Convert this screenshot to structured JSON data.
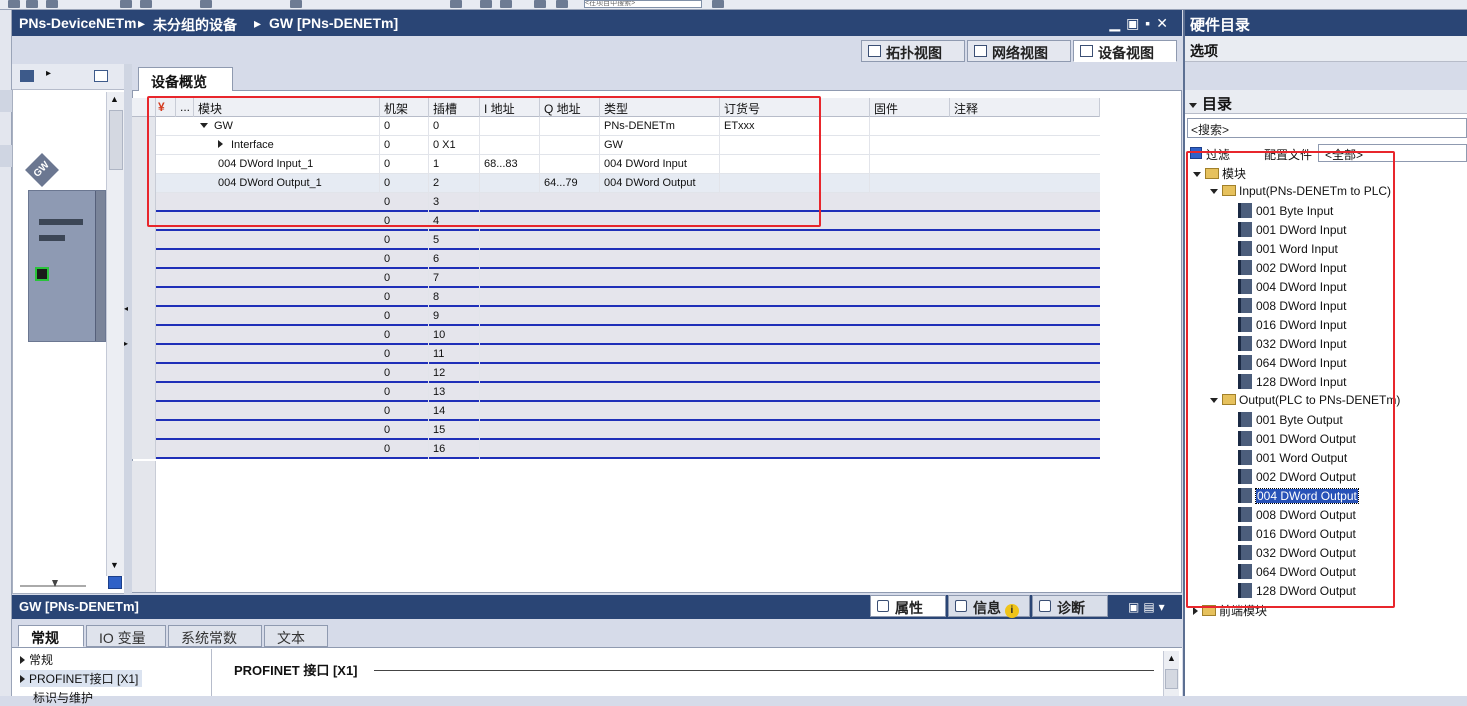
{
  "topbar": {
    "search_hint": "<在项目中搜索>"
  },
  "editor": {
    "breadcrumb": [
      "PNs-DeviceNETm",
      "未分组的设备",
      "GW [PNs-DENETm]"
    ],
    "separator": "▸",
    "view_tabs": [
      "拓扑视图",
      "网络视图",
      "设备视图"
    ],
    "active_view": "设备视图"
  },
  "graphic": {
    "device_tag": "GW"
  },
  "overview": {
    "tab_label": "设备概览",
    "columns": [
      "",
      "...",
      "模块",
      "机架",
      "插槽",
      "I 地址",
      "Q 地址",
      "类型",
      "订货号",
      "固件",
      "注释"
    ],
    "rows": [
      {
        "module": "GW",
        "rack": "0",
        "slot": "0",
        "i_addr": "",
        "q_addr": "",
        "type": "PNs-DENETm",
        "order": "ETxxx",
        "expand": "down",
        "indent": 0
      },
      {
        "module": "Interface",
        "rack": "0",
        "slot": "0 X1",
        "i_addr": "",
        "q_addr": "",
        "type": "GW",
        "order": "",
        "expand": "right",
        "indent": 1
      },
      {
        "module": "004 DWord Input_1",
        "rack": "0",
        "slot": "1",
        "i_addr": "68...83",
        "q_addr": "",
        "type": "004 DWord Input",
        "order": "",
        "expand": "",
        "indent": 1
      },
      {
        "module": "004 DWord Output_1",
        "rack": "0",
        "slot": "2",
        "i_addr": "",
        "q_addr": "64...79",
        "type": "004 DWord Output",
        "order": "",
        "expand": "",
        "indent": 1
      }
    ],
    "empty_slots": [
      "3",
      "4",
      "5",
      "6",
      "7",
      "8",
      "9",
      "10",
      "11",
      "12",
      "13",
      "14",
      "15",
      "16"
    ],
    "empty_rack": "0"
  },
  "inspector": {
    "title": "GW [PNs-DENETm]",
    "tabs": [
      "属性",
      "信息",
      "诊断"
    ],
    "info_badge": "i",
    "subtabs": [
      "常规",
      "IO 变量",
      "系统常数",
      "文本"
    ],
    "nav": [
      "常规",
      "PROFINET接口 [X1]",
      "标识与维护"
    ],
    "section_title": "PROFINET 接口 [X1]"
  },
  "catalog": {
    "title": "硬件目录",
    "options": "选项",
    "header": "目录",
    "search_placeholder": "<搜索>",
    "filter_label": "过滤",
    "profile_label": "配置文件",
    "profile_value": "<全部>",
    "tree": {
      "root": "模块",
      "input_folder": "Input(PNs-DENETm to PLC)",
      "inputs": [
        "001 Byte Input",
        "001 DWord Input",
        "001 Word Input",
        "002 DWord Input",
        "004 DWord Input",
        "008 DWord Input",
        "016 DWord Input",
        "032 DWord Input",
        "064 DWord Input",
        "128 DWord Input"
      ],
      "output_folder": "Output(PLC to PNs-DENETm)",
      "outputs": [
        "001 Byte Output",
        "001 DWord Output",
        "001 Word Output",
        "002 DWord Output",
        "004 DWord Output",
        "008 DWord Output",
        "016 DWord Output",
        "032 DWord Output",
        "064 DWord Output",
        "128 DWord Output"
      ],
      "selected": "004 DWord Output",
      "head_modules": "前端模块"
    }
  },
  "colors": {
    "title_bar": "#2a4575",
    "highlight_box": "#e8262c",
    "slot_line": "#1f2fb8",
    "selection": "#2852b8"
  }
}
